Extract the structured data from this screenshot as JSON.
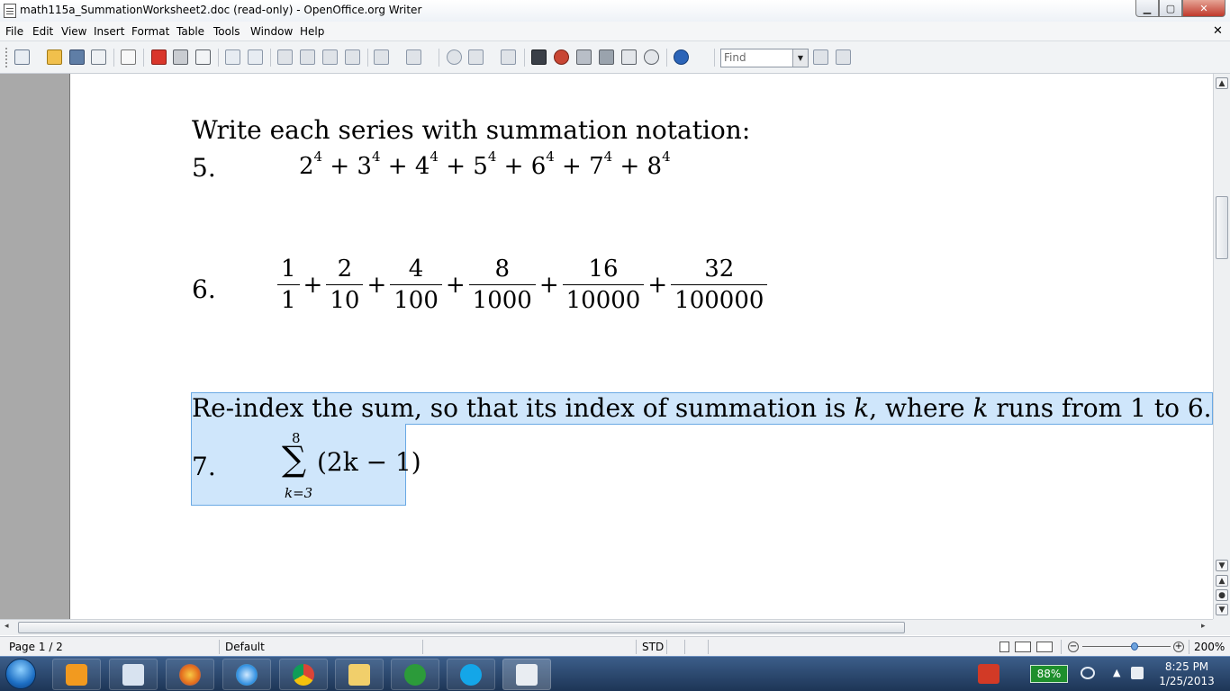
{
  "window": {
    "title": "math115a_SummationWorksheet2.doc (read-only) - OpenOffice.org Writer",
    "minimize_label": "▁",
    "maximize_label": "▢",
    "close_label": "✕"
  },
  "menubar": {
    "items": [
      "File",
      "Edit",
      "View",
      "Insert",
      "Format",
      "Table",
      "Tools",
      "Window",
      "Help"
    ],
    "close_label": "✕"
  },
  "toolbar": {
    "find_placeholder": "Find",
    "find_dropdown": "▼",
    "icons": [
      "new-document-icon",
      "open-icon",
      "save-icon",
      "email-icon",
      "edit-file-icon",
      "export-pdf-icon",
      "print-icon",
      "page-preview-icon",
      "spellcheck-icon",
      "autospellcheck-icon",
      "cut-icon",
      "copy-icon",
      "paste-icon",
      "clone-format-icon",
      "undo-icon",
      "redo-icon",
      "hyperlink-icon",
      "table-icon",
      "draw-functions-icon",
      "navigator-icon",
      "gallery-icon",
      "data-sources-icon",
      "formatting-marks-icon",
      "zoom-icon",
      "help-icon"
    ]
  },
  "document": {
    "heading1": "Write each series with summation notation:",
    "p5_number": "5.",
    "p5_terms": [
      {
        "base": "2",
        "exp": "4"
      },
      {
        "base": "3",
        "exp": "4"
      },
      {
        "base": "4",
        "exp": "4"
      },
      {
        "base": "5",
        "exp": "4"
      },
      {
        "base": "6",
        "exp": "4"
      },
      {
        "base": "7",
        "exp": "4"
      },
      {
        "base": "8",
        "exp": "4"
      }
    ],
    "plus": "+",
    "p6_number": "6.",
    "p6_fractions": [
      {
        "num": "1",
        "den": "1"
      },
      {
        "num": "2",
        "den": "10"
      },
      {
        "num": "4",
        "den": "100"
      },
      {
        "num": "8",
        "den": "1000"
      },
      {
        "num": "16",
        "den": "10000"
      },
      {
        "num": "32",
        "den": "100000"
      }
    ],
    "heading2_a": "Re-index the sum, so that its index of summation is ",
    "heading2_k1": "k",
    "heading2_b": ", where ",
    "heading2_k2": "k",
    "heading2_c": " runs from 1 to 6.",
    "p7_number": "7.",
    "sigma_upper": "8",
    "sigma_symbol": "∑",
    "sigma_lower": "k=3",
    "sigma_expr": "(2k − 1)"
  },
  "statusbar": {
    "page": "Page 1 / 2",
    "style": "Default",
    "mode": "STD",
    "zoom": "200%"
  },
  "taskbar": {
    "battery": "88%",
    "time": "8:25 PM",
    "date": "1/25/2013",
    "apps": [
      "media-player-icon",
      "remote-app-icon",
      "firefox-icon",
      "internet-explorer-icon",
      "chrome-icon",
      "file-explorer-icon",
      "utorrent-icon",
      "skype-icon",
      "openoffice-writer-icon"
    ]
  },
  "colors": {
    "selection": "#cfe6fb",
    "selection_border": "#6aa9e4",
    "taskbar": "#1d3556"
  }
}
